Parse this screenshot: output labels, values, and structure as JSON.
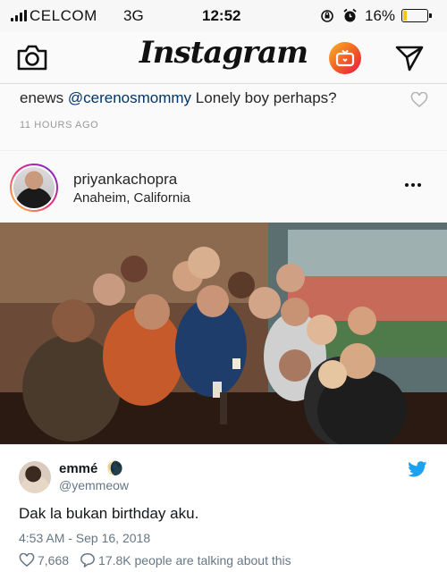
{
  "status_bar": {
    "carrier": "CELCOM",
    "network": "3G",
    "time": "12:52",
    "battery_percent_text": "16%",
    "battery_level": 0.16,
    "icons": [
      "orientation-lock-icon",
      "alarm-icon"
    ]
  },
  "ig_header": {
    "logo_text": "Instagram",
    "icons": [
      "camera-icon",
      "igtv-icon",
      "direct-message-icon"
    ]
  },
  "comment": {
    "user": "enews",
    "mention": "@cerenosmommy",
    "text": "Lonely boy perhaps?",
    "time_ago": "11 HOURS AGO"
  },
  "post": {
    "username": "priyankachopra",
    "location": "Anaheim, California",
    "image_description": "group-photo"
  },
  "tweet": {
    "name": "emmé",
    "name_emoji": "🌘",
    "handle": "@yemmeow",
    "text": "Dak la bukan birthday aku.",
    "timestamp": "4:53 AM - Sep 16, 2018",
    "likes": "7,668",
    "talking": "17.8K people are talking about this"
  },
  "colors": {
    "twitter_blue": "#1da1f2",
    "mention_blue": "#003569",
    "muted_gray": "#657786",
    "igtv_orange": "#f15a24"
  }
}
